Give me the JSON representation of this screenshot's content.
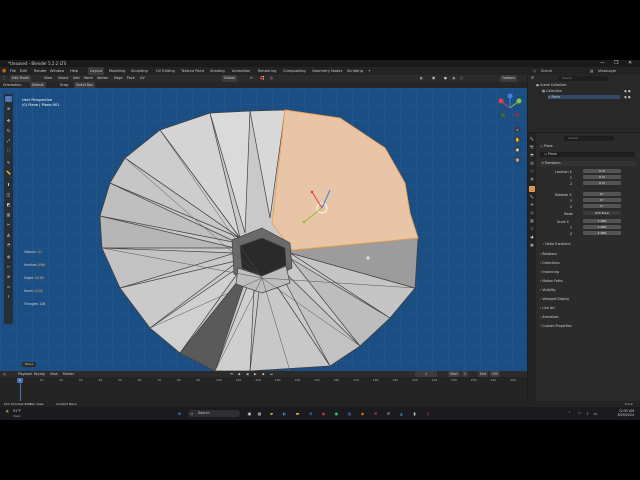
{
  "window": {
    "title": "*Unsaved - Blender 5.2.2 LTS",
    "controls": [
      "—",
      "❐",
      "✕"
    ]
  },
  "menubar": {
    "menus": [
      "File",
      "Edit",
      "Render",
      "Window",
      "Help"
    ],
    "workspaces": [
      "Layout",
      "Modeling",
      "Sculpting",
      "UV Editing",
      "Texture Paint",
      "Shading",
      "Animation",
      "Rendering",
      "Compositing",
      "Geometry Nodes",
      "Scripting"
    ],
    "active_workspace": "Layout",
    "add_tab": "+",
    "scene_label": "Scene",
    "viewlayer_label": "ViewLayer"
  },
  "viewport_header": {
    "mode": "Edit Mode",
    "menus": [
      "View",
      "Select",
      "Add",
      "Mesh",
      "Vertex",
      "Edge",
      "Face",
      "UV"
    ],
    "orientation": "Global",
    "options_label": "Options"
  },
  "tool_header": {
    "orientation_label": "Orientation:",
    "orientation_value": "Default",
    "drag_label": "Drag:",
    "drag_value": "Select Box"
  },
  "viewport": {
    "view_name": "User Perspective",
    "object_name": "(0) Plane | Plane.001",
    "stats": [
      {
        "label": "Objects",
        "value": "1/1"
      },
      {
        "label": "Vertices",
        "value": "0/66"
      },
      {
        "label": "Edges",
        "value": "5/165"
      },
      {
        "label": "Faces",
        "value": "1/100"
      },
      {
        "label": "Triangles",
        "value": "128"
      }
    ],
    "last_op": "Move",
    "colors": {
      "bg": "#1b4f84",
      "mesh": "#c9c9c9",
      "selected_face": "#e8c5a6",
      "edge": "#3c3c3c"
    }
  },
  "tools": [
    "select-icon",
    "cursor-icon",
    "move-icon",
    "rotate-icon",
    "scale-icon",
    "transform-icon",
    "annotate-icon",
    "measure-icon",
    "extrude-icon",
    "inset-icon",
    "bevel-icon",
    "loopcut-icon",
    "knife-icon",
    "polybuild-icon",
    "spin-icon",
    "smooth-icon",
    "edge-slide-icon",
    "shrink-icon",
    "shear-icon",
    "rip-icon"
  ],
  "timeline": {
    "menus": [
      "Playback",
      "Keying",
      "View",
      "Marker"
    ],
    "current_frame": "1",
    "start_label": "Start",
    "start_value": "1",
    "end_label": "End",
    "end_value": "250",
    "ticks": [
      "0",
      "10",
      "20",
      "30",
      "40",
      "50",
      "60",
      "70",
      "80",
      "90",
      "100",
      "110",
      "120",
      "130",
      "140",
      "150",
      "160",
      "170",
      "180",
      "190",
      "200",
      "210",
      "220",
      "230",
      "240",
      "250"
    ]
  },
  "statusbar": {
    "left": "Pick Shortest Path",
    "mid": "Pan View",
    "right": "Context Menu",
    "version": "5.2.2"
  },
  "outliner": {
    "search_placeholder": "Search",
    "items": [
      "Scene Collection",
      "Collection",
      "Plane"
    ]
  },
  "properties": {
    "search_placeholder": "Search",
    "object_name": "Plane",
    "data_name": "Plane",
    "transform_label": "Transform",
    "location_label": "Location X",
    "location": [
      "0 m",
      "0 m",
      "0 m"
    ],
    "rotation_label": "Rotation X",
    "rotation": [
      "0°",
      "0°",
      "0°"
    ],
    "mode_label": "Mode",
    "mode_value": "XYZ Euler",
    "scale_label": "Scale X",
    "scale": [
      "1.000",
      "1.000",
      "1.000"
    ],
    "axis_labels": [
      "X",
      "Y",
      "Z"
    ],
    "panels": [
      "Delta Transform",
      "Relations",
      "Collections",
      "Instancing",
      "Motion Paths",
      "Visibility",
      "Viewport Display",
      "Line Art",
      "Animation",
      "Custom Properties"
    ]
  },
  "taskbar": {
    "weather_temp": "91°F",
    "weather_desc": "Clear",
    "search_label": "Search",
    "apps": [
      "explorer-icon",
      "browser-icon",
      "files-icon",
      "edge-icon",
      "chrome-icon",
      "spotify-icon",
      "store-icon",
      "blender-icon",
      "mail-icon",
      "settings-icon",
      "photos-icon",
      "terminal-icon",
      "music-icon"
    ],
    "time": "12:55 AM",
    "date": "6/29/2024"
  }
}
